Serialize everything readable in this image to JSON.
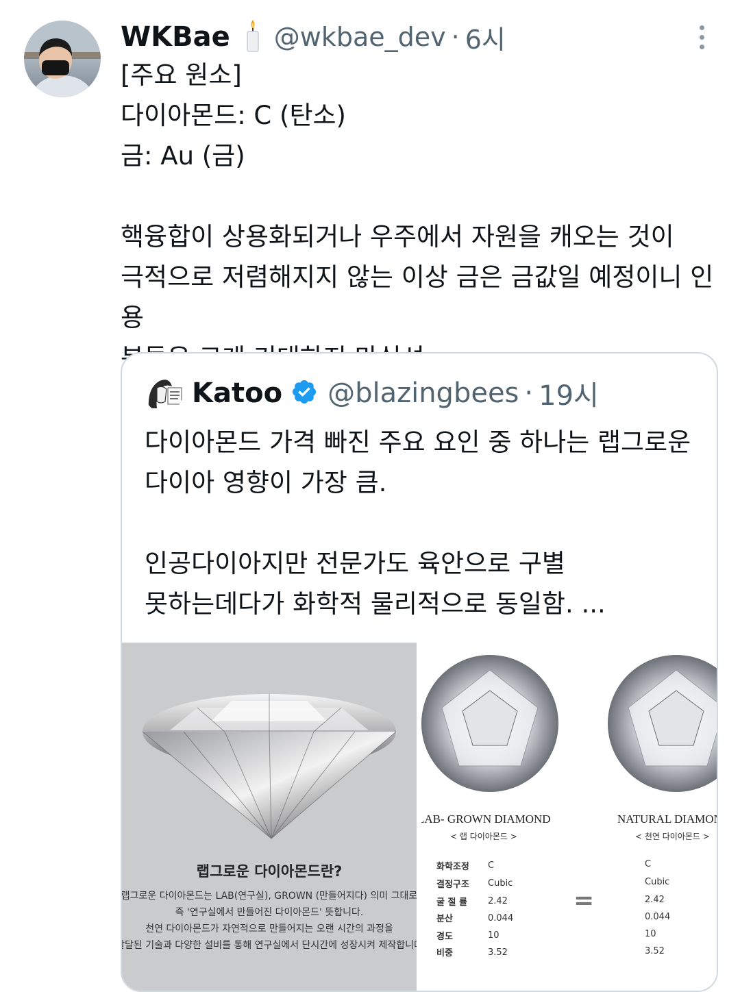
{
  "tweet": {
    "author_name": "WKBae",
    "handle": "@wkbae_dev",
    "separator": "·",
    "time": "6시",
    "text": "[주요 원소]\n다이아몬드: C (탄소)\n금: Au (금)\n\n핵융합이 상용화되거나 우주에서 자원을 캐오는 것이\n극적으로 저렴해지지 않는 이상 금은 금값일 예정이니 인용\n분들은 크게 기대하지 마십셔"
  },
  "quoted_tweet": {
    "author_name": "Katoo",
    "handle": "@blazingbees",
    "separator": "·",
    "time": "19시",
    "text": "다이아몬드 가격 빠진 주요 요인 중 하나는 랩그로운\n다이아 영향이 가장 큼.\n\n인공다이아지만 전문가도 육안으로 구별\n못하는데다가 화학적 물리적으로 동일함. ..."
  },
  "media_left": {
    "title": "랩그로운 다이아몬드란?",
    "body": "랩그로운 다이아몬드는 LAB(연구실), GROWN (만들어지다) 의미 그대로\n즉 '연구실에서 만들어진 다이아몬드' 뜻합니다.\n천연 다이아몬드가 자연적으로 만들어지는 오랜 시간의 과정을\n발달된 기술과 다양한 설비를 통해 연구실에서 단시간에 성장시켜 제작합니다"
  },
  "media_right": {
    "lab_title": "LAB- GROWN DIAMOND",
    "lab_sub": "< 랩 다이아몬드 >",
    "natural_title": "NATURAL DIAMOND",
    "natural_sub": "< 천연 다이아몬드 >",
    "equals": "=",
    "specs": [
      {
        "label": "화학조정",
        "lab": "C",
        "natural": "C"
      },
      {
        "label": "결정구조",
        "lab": "Cubic",
        "natural": "Cubic"
      },
      {
        "label": "굴 절 률",
        "lab": "2.42",
        "natural": "2.42"
      },
      {
        "label": "분산",
        "lab": "0.044",
        "natural": "0.044"
      },
      {
        "label": "경도",
        "lab": "10",
        "natural": "10"
      },
      {
        "label": "비중",
        "lab": "3.52",
        "natural": "3.52"
      }
    ]
  },
  "icons": {
    "candle": "candle-icon",
    "verified": "verified-badge-icon",
    "more": "more-options-icon"
  },
  "colors": {
    "text": "#0f1419",
    "secondary": "#536471",
    "verified": "#1d9bf0",
    "border": "#cfd9de"
  }
}
